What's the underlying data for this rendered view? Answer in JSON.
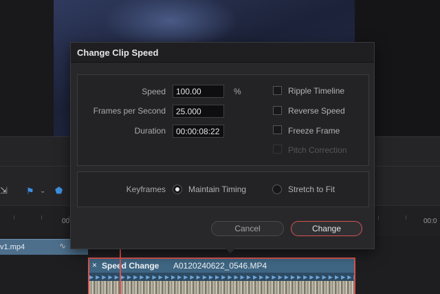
{
  "background": {
    "audio_clip_label": "v1.mp4",
    "ruler_labels": [
      "00",
      "00:0"
    ],
    "video_clip": {
      "close_glyph": "×",
      "effect_label": "Speed Change",
      "file_name": "A0120240622_0546.MP4"
    }
  },
  "dialog": {
    "title": "Change Clip Speed",
    "speed": {
      "label": "Speed",
      "value": "100.00",
      "unit": "%"
    },
    "fps": {
      "label": "Frames per Second",
      "value": "25.000"
    },
    "duration": {
      "label": "Duration",
      "value": "00:00:08:22"
    },
    "options": {
      "ripple": {
        "label": "Ripple Timeline",
        "checked": false
      },
      "reverse": {
        "label": "Reverse Speed",
        "checked": false
      },
      "freeze": {
        "label": "Freeze Frame",
        "checked": false
      },
      "pitch": {
        "label": "Pitch Correction",
        "checked": false,
        "disabled": true
      }
    },
    "keyframes": {
      "label": "Keyframes",
      "maintain": {
        "label": "Maintain Timing",
        "selected": true
      },
      "stretch": {
        "label": "Stretch to Fit",
        "selected": false
      }
    },
    "cancel_label": "Cancel",
    "change_label": "Change"
  },
  "colors": {
    "accent": "#d9534f",
    "clip": "#3f6683",
    "panel": "#28282b"
  }
}
